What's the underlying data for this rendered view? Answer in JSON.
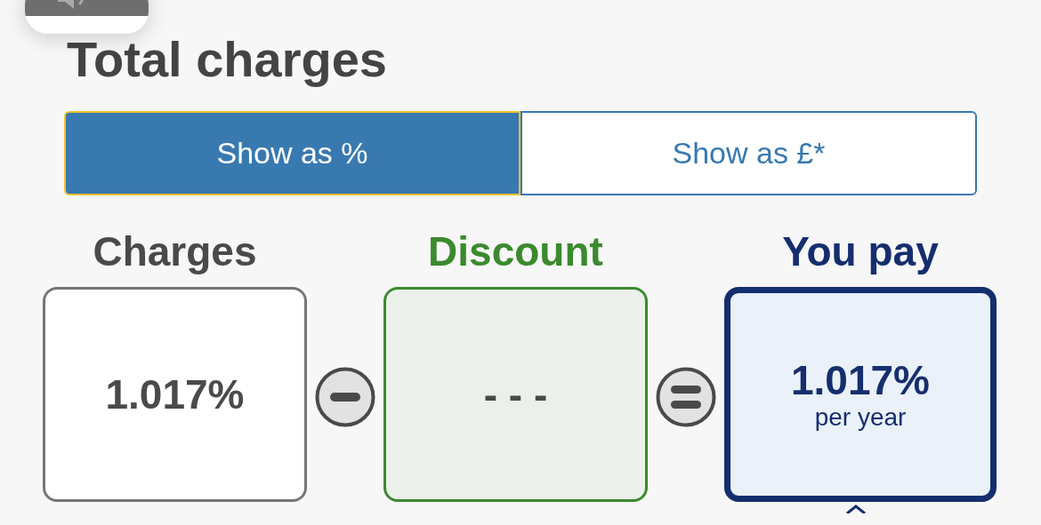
{
  "title": "Total charges",
  "toggle": [
    {
      "label": "Show as %",
      "selected": true
    },
    {
      "label": "Show as £*",
      "selected": false
    }
  ],
  "columns": [
    {
      "heading": "Charges",
      "value": "1.017%",
      "kind": "neutral"
    },
    {
      "heading": "Discount",
      "value": "- - -",
      "kind": "discount",
      "operator": {
        "kind": "minus"
      }
    },
    {
      "heading": "You pay",
      "value": "1.017%",
      "note": "per year",
      "kind": "result",
      "operator": {
        "kind": "equals"
      }
    }
  ]
}
